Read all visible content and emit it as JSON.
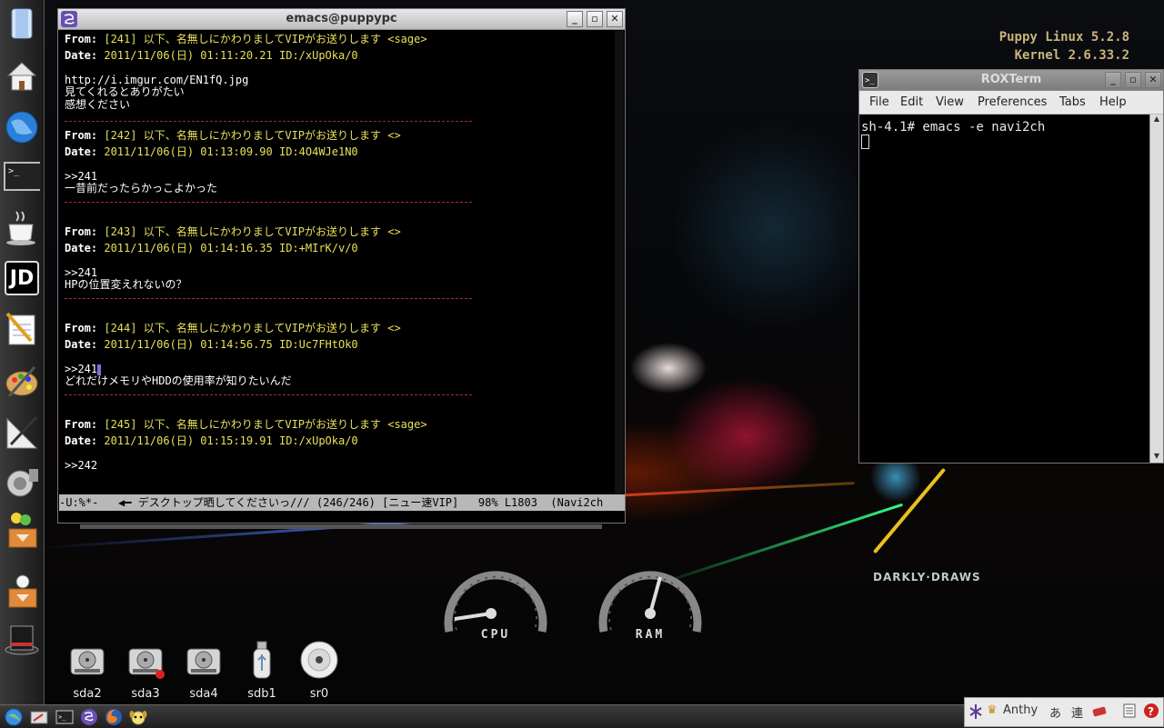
{
  "desktop": {
    "info_lines": [
      "Puppy Linux 5.2.8",
      "Kernel 2.6.33.2"
    ],
    "gauges": [
      {
        "label": "CPU"
      },
      {
        "label": "RAM"
      }
    ],
    "wallpaper_brand": "DARKLY·DRAWS"
  },
  "launcher": {
    "items": [
      {
        "name": "files",
        "label": ""
      },
      {
        "name": "home",
        "label": ""
      },
      {
        "name": "browser",
        "label": ""
      },
      {
        "name": "terminal",
        "label": ">_"
      },
      {
        "name": "java",
        "label": ""
      },
      {
        "name": "jd",
        "label": "JD"
      },
      {
        "name": "notes",
        "label": ""
      },
      {
        "name": "paint",
        "label": ""
      },
      {
        "name": "draw",
        "label": ""
      },
      {
        "name": "audio",
        "label": ""
      },
      {
        "name": "packages",
        "label": ""
      },
      {
        "name": "puppy-package",
        "label": ""
      },
      {
        "name": "magic-hat",
        "label": ""
      }
    ]
  },
  "emacs": {
    "title": "emacs@puppypc",
    "posts": [
      {
        "from_key": "From:",
        "from": " [241] 以下、名無しにかわりましてVIPがお送りします <sage>",
        "date_key": "Date:",
        "date": " 2011/11/06(日) 01:11:20.21 ID:/xUpOka/0",
        "lines": [
          "http://i.imgur.com/EN1fQ.jpg",
          "見てくれるとありがたい",
          "感想ください"
        ]
      },
      {
        "from_key": "From:",
        "from": " [242] 以下、名無しにかわりましてVIPがお送りします <>",
        "date_key": "Date:",
        "date": " 2011/11/06(日) 01:13:09.90 ID:4O4WJe1N0",
        "lines": [
          ">>241",
          "一昔前だったらかっこよかった"
        ]
      },
      {
        "from_key": "From:",
        "from": " [243] 以下、名無しにかわりましてVIPがお送りします <>",
        "date_key": "Date:",
        "date": " 2011/11/06(日) 01:14:16.35 ID:+MIrK/v/0",
        "lines": [
          ">>241",
          "HPの位置変えれないの？"
        ]
      },
      {
        "from_key": "From:",
        "from": " [244] 以下、名無しにかわりましてVIPがお送りします <>",
        "date_key": "Date:",
        "date": " 2011/11/06(日) 01:14:56.75 ID:Uc7FHtOk0",
        "lines": [
          ">>241",
          "どれだけメモリやHDDの使用率が知りたいんだ"
        ]
      },
      {
        "from_key": "From:",
        "from": " [245] 以下、名無しにかわりましてVIPがお送りします <sage>",
        "date_key": "Date:",
        "date": " 2011/11/06(日) 01:15:19.91 ID:/xUpOka/0",
        "lines": [
          ">>242"
        ]
      }
    ],
    "modeline": "-U:%*-   ◀━ デスクトップ晒してくださいっ/// (246/246) [ニュー速VIP]   98% L1803  (Navi2ch"
  },
  "roxterm": {
    "title": "ROXTerm",
    "menu": [
      "File",
      "Edit",
      "View",
      "Preferences",
      "Tabs",
      "Help"
    ],
    "command_line": "sh-4.1# emacs -e navi2ch"
  },
  "drives": [
    {
      "label": "sda2",
      "type": "hdd"
    },
    {
      "label": "sda3",
      "type": "hdd-mounted"
    },
    {
      "label": "sda4",
      "type": "hdd"
    },
    {
      "label": "sdb1",
      "type": "usb"
    },
    {
      "label": "sr0",
      "type": "cdrom"
    }
  ],
  "tray": {
    "ime_label": "Anthy",
    "ime_mode": "あ",
    "ime_conv": "連"
  }
}
